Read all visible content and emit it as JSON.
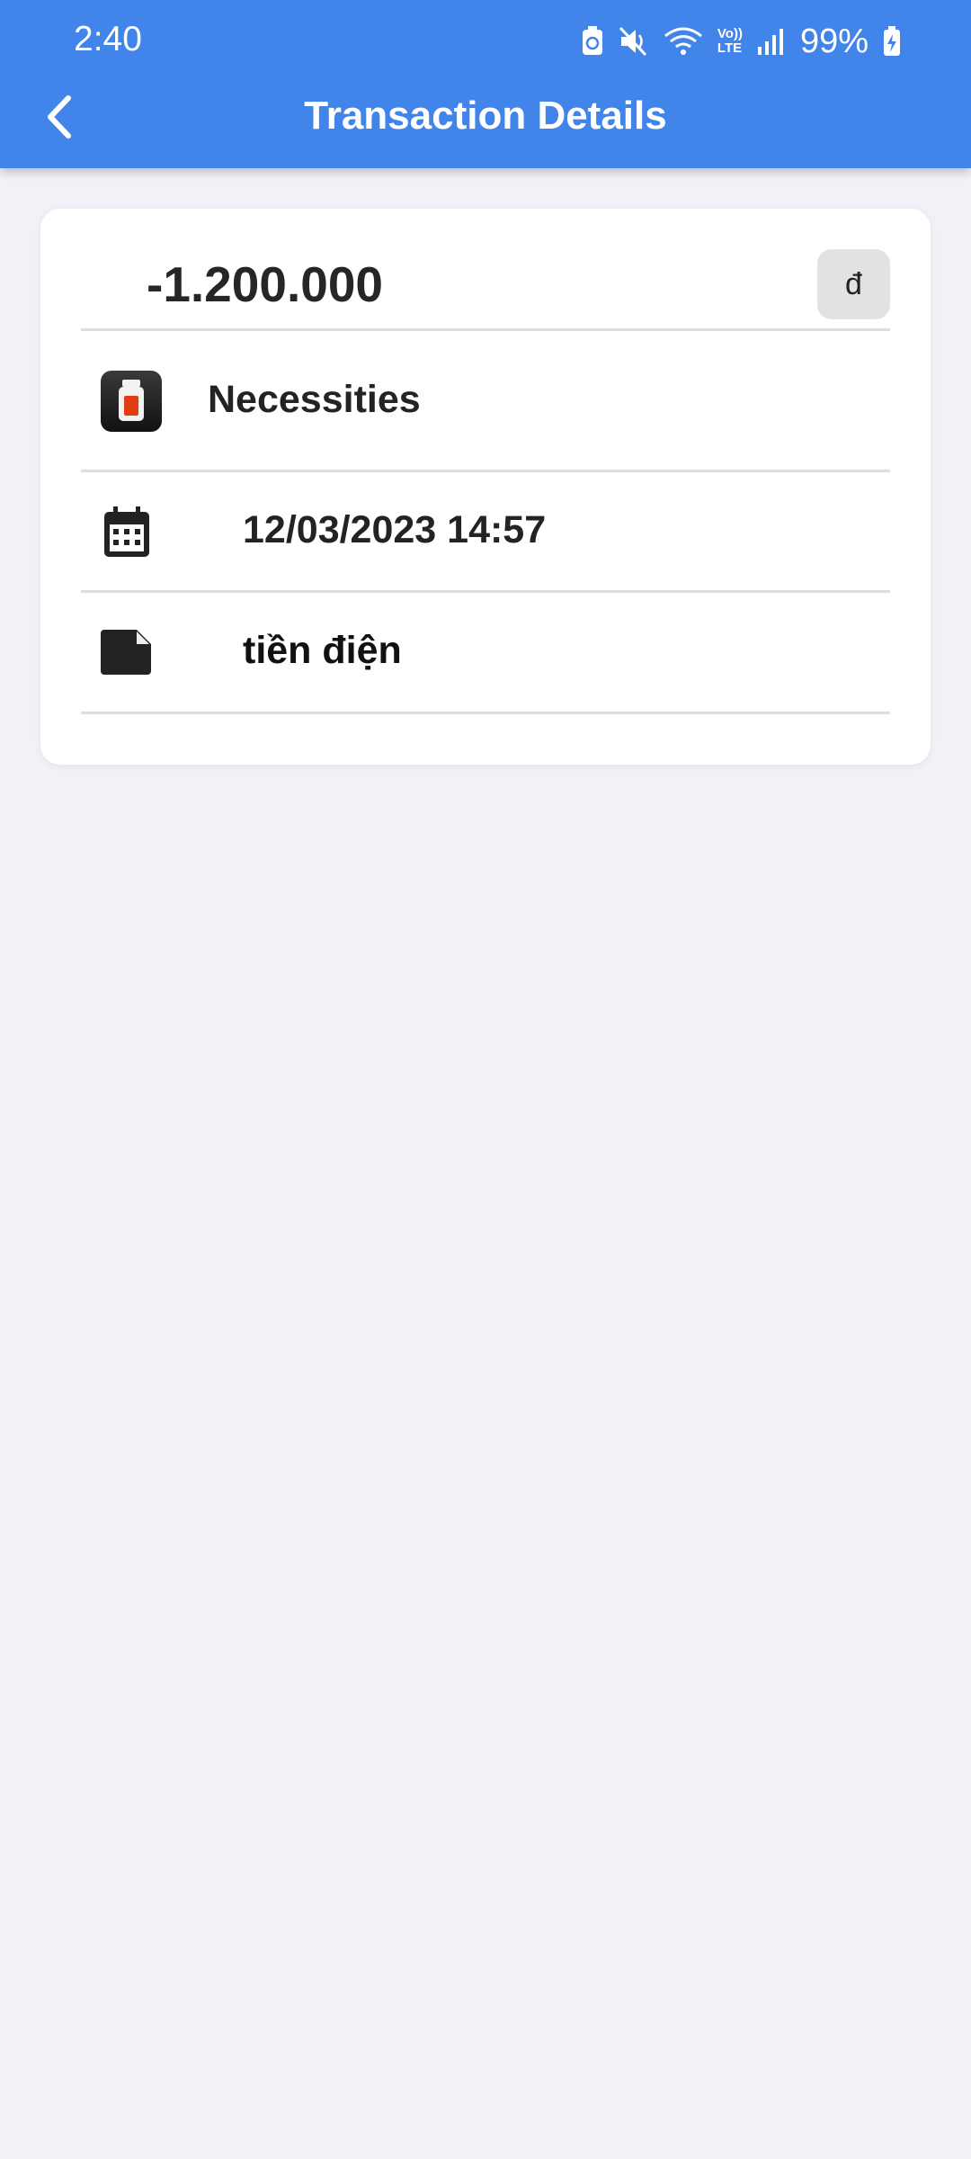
{
  "status_bar": {
    "time": "2:40",
    "battery": "99%",
    "icons": [
      "battery-saver-icon",
      "mute-icon",
      "wifi-icon",
      "volte-icon",
      "signal-icon",
      "battery-charging-icon"
    ],
    "volte_label_top": "Vo))",
    "volte_label_bottom": "LTE"
  },
  "app_bar": {
    "title": "Transaction Details",
    "back_icon": "chevron-left-icon",
    "background_color": "#4285ea"
  },
  "transaction": {
    "amount": "-1.200.000",
    "currency_symbol": "đ",
    "category": "Necessities",
    "category_icon": "jar-icon",
    "datetime": "12/03/2023 14:57",
    "date_icon": "calendar-icon",
    "note": "tiền điện",
    "note_icon": "note-icon"
  }
}
